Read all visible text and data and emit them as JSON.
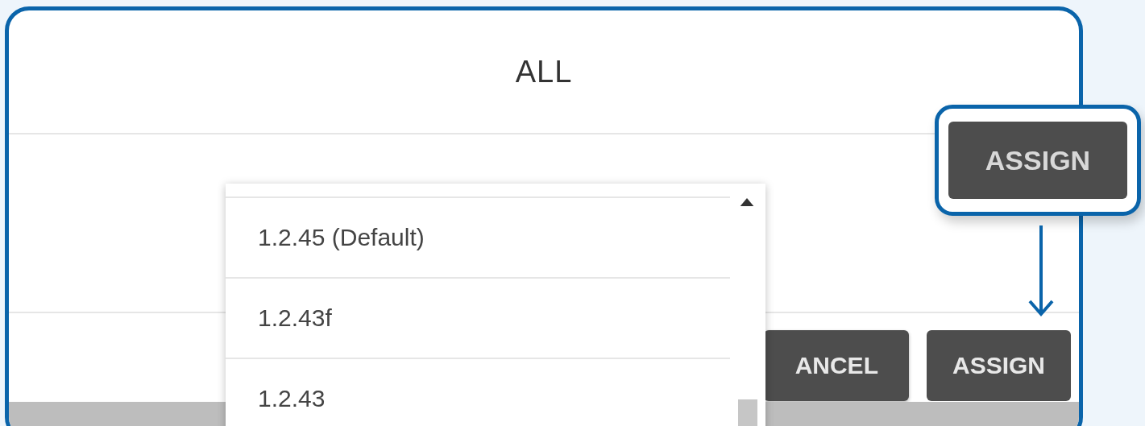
{
  "dialog": {
    "title": "ALL",
    "buttons": [
      "ANCEL",
      "ASSIGN"
    ]
  },
  "dropdown": {
    "options": [
      {
        "label": "1.2.45 (Default)",
        "selected": false
      },
      {
        "label": "1.2.43f",
        "selected": false
      },
      {
        "label": "1.2.43",
        "selected": false
      }
    ]
  },
  "callout": {
    "button": "ASSIGN"
  }
}
